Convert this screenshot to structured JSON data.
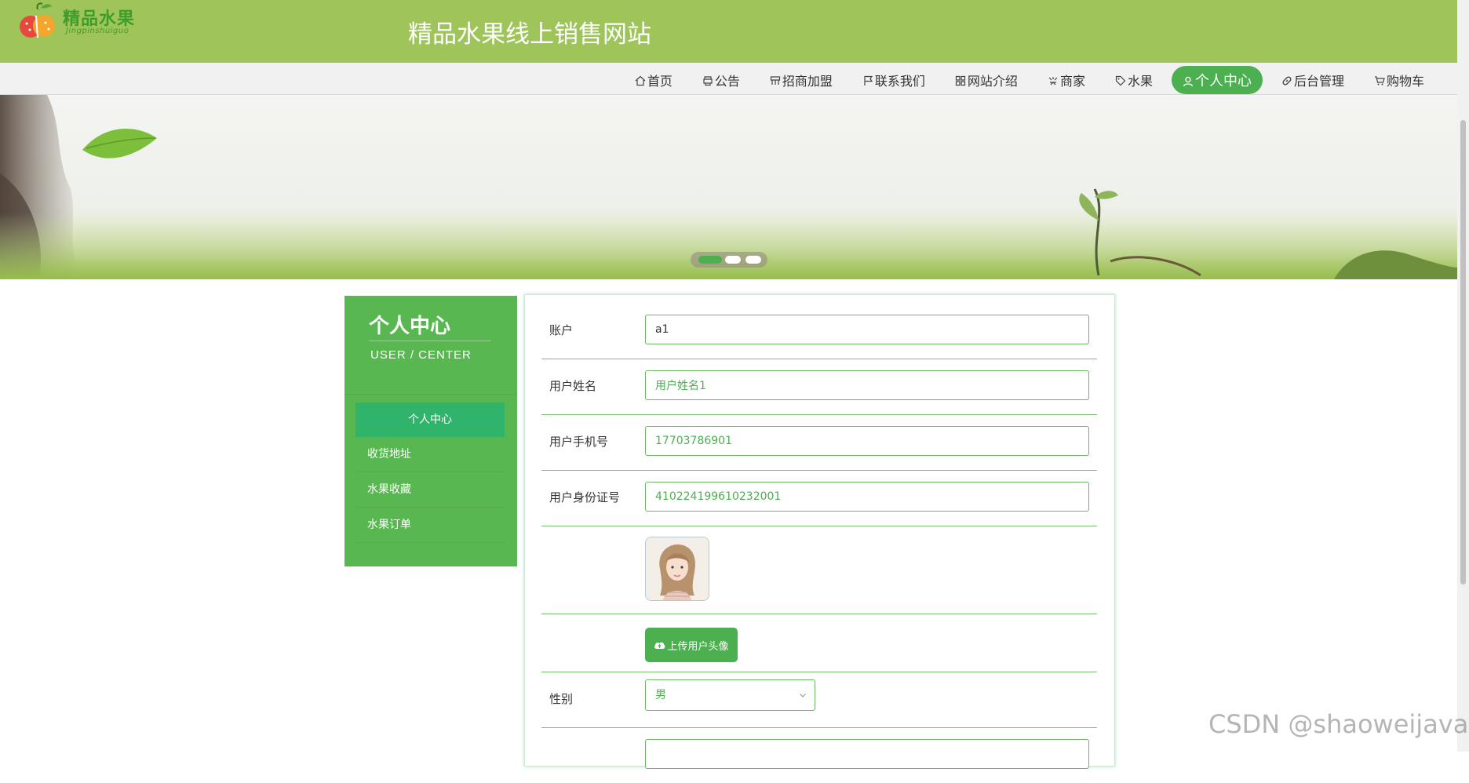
{
  "header": {
    "logo_text": "精品水果",
    "logo_sub": "Jingpinshuiguo",
    "site_title": "精品水果线上销售网站"
  },
  "nav": {
    "items": [
      {
        "label": "首页",
        "icon": "home-icon"
      },
      {
        "label": "公告",
        "icon": "announcement-icon"
      },
      {
        "label": "招商加盟",
        "icon": "franchise-icon"
      },
      {
        "label": "联系我们",
        "icon": "flag-icon"
      },
      {
        "label": "网站介绍",
        "icon": "grid-icon"
      },
      {
        "label": "商家",
        "icon": "shop-icon"
      },
      {
        "label": "水果",
        "icon": "tag-icon"
      },
      {
        "label": "个人中心",
        "icon": "user-icon"
      },
      {
        "label": "后台管理",
        "icon": "link-icon"
      },
      {
        "label": "购物车",
        "icon": "cart-icon"
      }
    ],
    "active_label": "个人中心"
  },
  "sidebar": {
    "title": "个人中心",
    "subtitle": "USER / CENTER",
    "items": [
      {
        "label": "个人中心"
      },
      {
        "label": "收货地址"
      },
      {
        "label": "水果收藏"
      },
      {
        "label": "水果订单"
      }
    ]
  },
  "form": {
    "account": {
      "label": "账户",
      "value": "a1"
    },
    "name": {
      "label": "用户姓名",
      "value": "用户姓名1"
    },
    "phone": {
      "label": "用户手机号",
      "value": "17703786901"
    },
    "id_card": {
      "label": "用户身份证号",
      "value": "410224199610232001"
    },
    "upload_label": "上传用户头像",
    "gender": {
      "label": "性别",
      "value": "男"
    }
  },
  "colors": {
    "header_bg": "#9fc55a",
    "accent": "#4caf50",
    "sidebar_bg": "#59b751",
    "sidebar_active": "#30b36b"
  },
  "watermark": "CSDN @shaoweijava"
}
